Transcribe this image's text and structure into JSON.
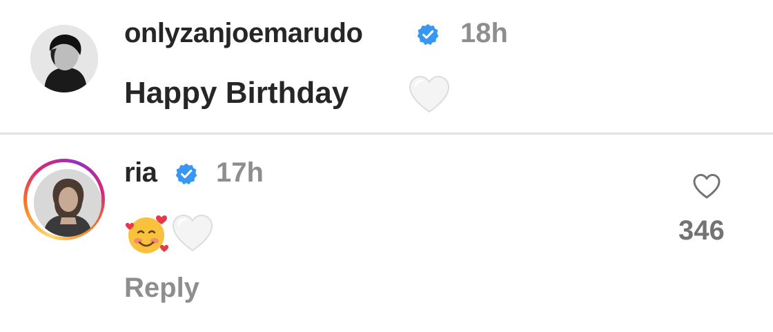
{
  "comments": [
    {
      "username": "onlyzanjoemarudo",
      "verified": true,
      "time": "18h",
      "text": "Happy Birthday",
      "emoji": [
        "white-heart"
      ]
    },
    {
      "username": "ria",
      "verified": true,
      "time": "17h",
      "text": "",
      "emoji": [
        "smiling-face-with-hearts",
        "white-heart"
      ],
      "reply_label": "Reply",
      "like_count": "346"
    }
  ],
  "colors": {
    "verified_badge": "#3897f0",
    "primary_text": "#262626",
    "secondary_text": "#8e8e8e"
  }
}
